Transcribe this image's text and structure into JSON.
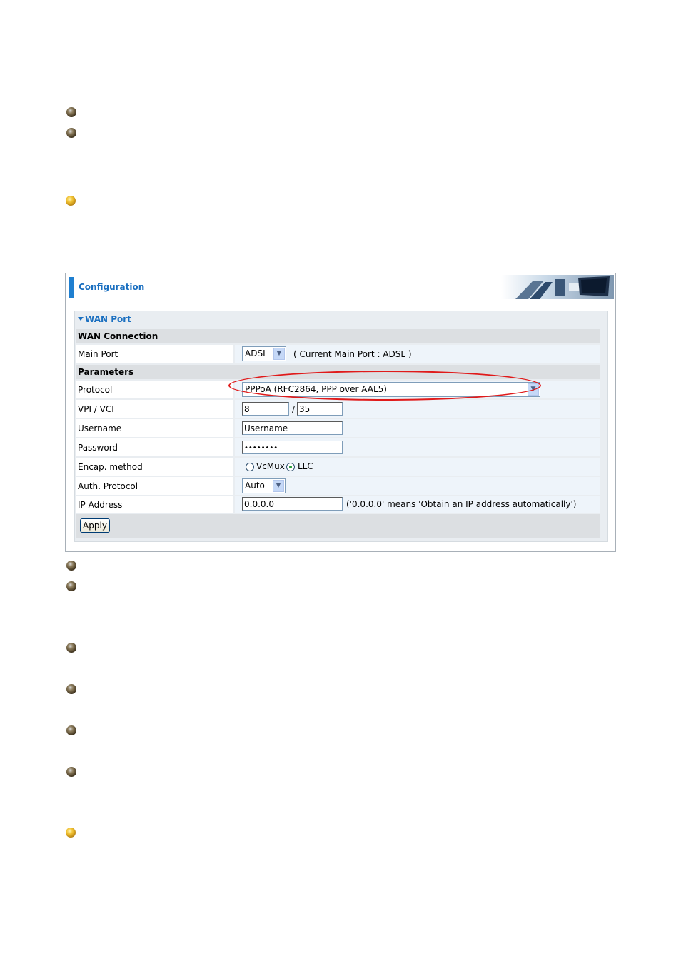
{
  "config": {
    "title": "Configuration",
    "section_title": "WAN Port",
    "wan_connection_header": "WAN Connection",
    "main_port": {
      "label": "Main Port",
      "value": "ADSL",
      "note": "( Current Main Port : ADSL )"
    },
    "parameters_header": "Parameters",
    "protocol": {
      "label": "Protocol",
      "value": "PPPoA (RFC2864, PPP over AAL5)"
    },
    "vpi_vci": {
      "label": "VPI / VCI",
      "vpi": "8",
      "separator": "/",
      "vci": "35"
    },
    "username": {
      "label": "Username",
      "value": "Username"
    },
    "password": {
      "label": "Password",
      "value": "••••••••"
    },
    "encap": {
      "label": "Encap. method",
      "option1": "VcMux",
      "option2": "LLC",
      "selected": "LLC"
    },
    "auth": {
      "label": "Auth. Protocol",
      "value": "Auto"
    },
    "ip": {
      "label": "IP Address",
      "value": "0.0.0.0",
      "note": "('0.0.0.0' means 'Obtain an IP address automatically')"
    },
    "apply_label": "Apply"
  },
  "annotation_color": "#e01a1a",
  "accent_color": "#1a6fc0"
}
